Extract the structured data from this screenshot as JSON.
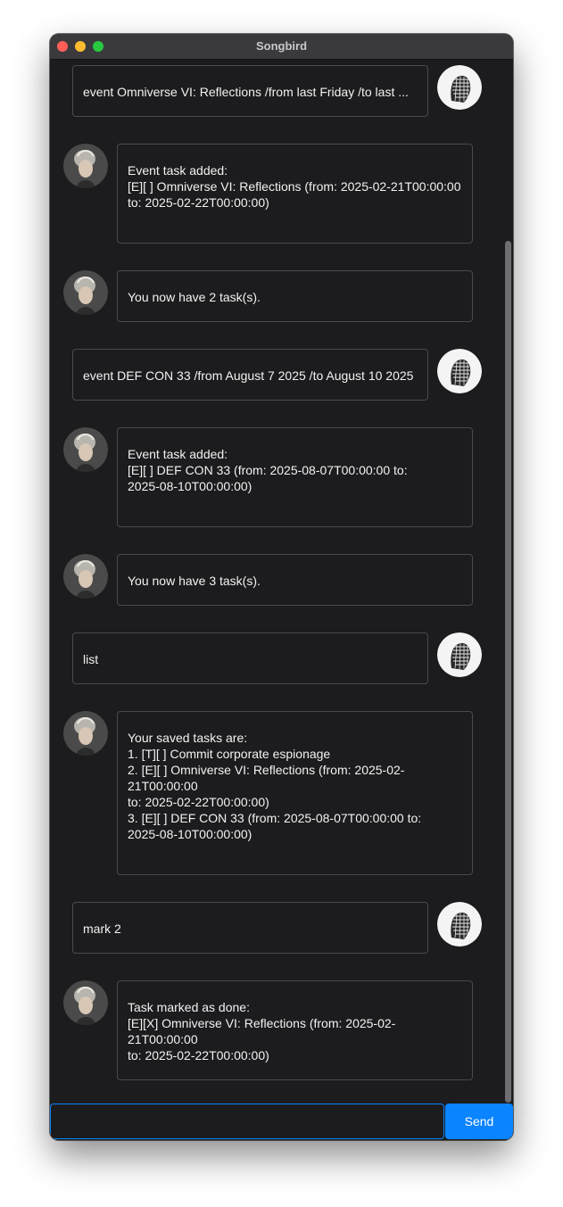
{
  "window": {
    "title": "Songbird"
  },
  "messages": [
    {
      "from": "user",
      "text": "event Omniverse VI: Reflections /from last Friday /to last ..."
    },
    {
      "from": "bot",
      "text": "Event task added:\n[E][ ] Omniverse VI: Reflections (from: 2025-02-21T00:00:00\nto: 2025-02-22T00:00:00)"
    },
    {
      "from": "bot",
      "text": "You now have 2 task(s)."
    },
    {
      "from": "user",
      "text": "event DEF CON 33 /from August 7 2025 /to August 10 2025"
    },
    {
      "from": "bot",
      "text": "Event task added:\n[E][ ] DEF CON 33 (from: 2025-08-07T00:00:00 to:\n2025-08-10T00:00:00)"
    },
    {
      "from": "bot",
      "text": "You now have 3 task(s)."
    },
    {
      "from": "user",
      "text": "list"
    },
    {
      "from": "bot",
      "text": "Your saved tasks are:\n1. [T][ ] Commit corporate espionage\n2. [E][ ] Omniverse VI: Reflections (from: 2025-02-21T00:00:00\nto: 2025-02-22T00:00:00)\n3. [E][ ] DEF CON 33 (from: 2025-08-07T00:00:00 to:\n2025-08-10T00:00:00)"
    },
    {
      "from": "user",
      "text": "mark 2"
    },
    {
      "from": "bot",
      "text": "Task marked as done:\n[E][X] Omniverse VI: Reflections (from: 2025-02-21T00:00:00\nto: 2025-02-22T00:00:00)"
    }
  ],
  "input": {
    "value": "",
    "placeholder": ""
  },
  "send_button": {
    "label": "Send"
  },
  "colors": {
    "accent": "#0a84ff",
    "background": "#1c1c1e",
    "bubble_border": "#4a4a4e"
  }
}
